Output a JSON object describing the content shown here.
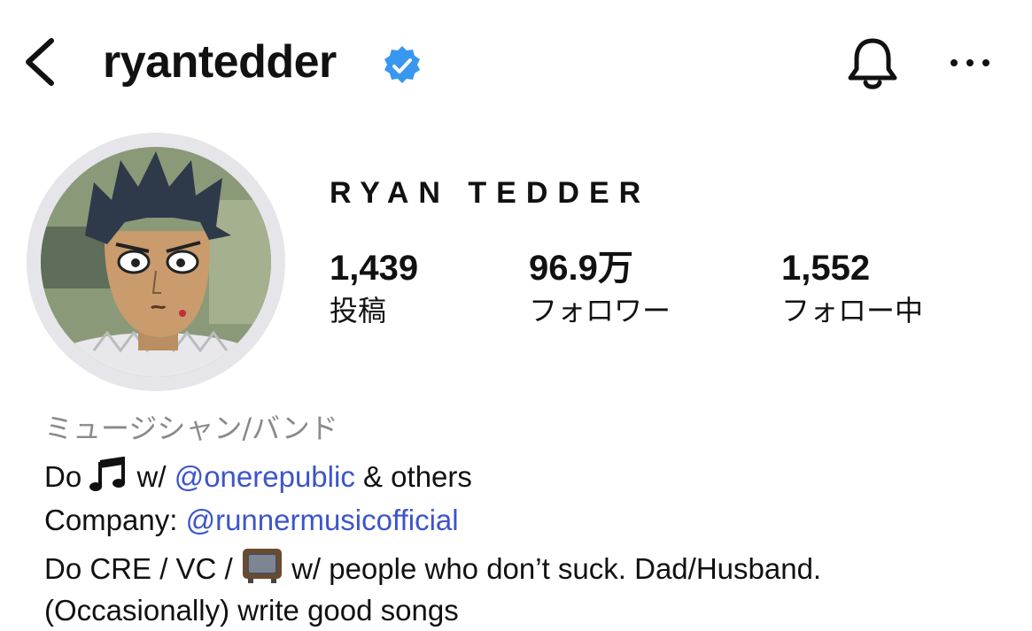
{
  "header": {
    "username": "ryantedder",
    "icons": [
      "back-chevron-icon",
      "verified-badge-icon",
      "bell-icon",
      "more-options-icon"
    ]
  },
  "profile": {
    "full_name": "RYAN TEDDER",
    "stats": [
      {
        "count": "1,439",
        "label": "投稿"
      },
      {
        "count": "96.9万",
        "label": "フォロワー"
      },
      {
        "count": "1,552",
        "label": "フォロー中"
      }
    ],
    "category": "ミュージシャン/バンド"
  },
  "bio": {
    "line1": {
      "pre": "Do",
      "emoji": "music-notes-icon",
      "mid": "w/",
      "mention": "@onerepublic",
      "post": "& others"
    },
    "line2": {
      "pre": "Company:",
      "mention": "@runnermusicofficial"
    },
    "line3": {
      "pre": "Do CRE / VC /",
      "emoji": "television-icon",
      "post": "w/ people who don’t suck.  Dad/Husband."
    },
    "line4": "(Occasionally) write good songs"
  },
  "colors": {
    "link": "#3d55c9",
    "verified": "#3897f0",
    "muted": "#8a8a8e"
  }
}
